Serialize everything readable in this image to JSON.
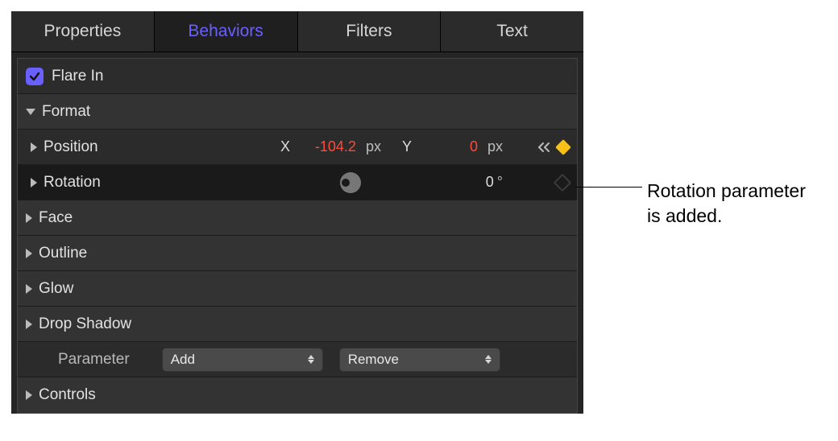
{
  "tabs": {
    "properties": "Properties",
    "behaviors": "Behaviors",
    "filters": "Filters",
    "text": "Text"
  },
  "header": {
    "title": "Flare In"
  },
  "sections": {
    "format": "Format",
    "face": "Face",
    "outline": "Outline",
    "glow": "Glow",
    "dropShadow": "Drop Shadow",
    "controls": "Controls"
  },
  "position": {
    "label": "Position",
    "xLabel": "X",
    "xValue": "-104.2",
    "xUnit": "px",
    "yLabel": "Y",
    "yValue": "0",
    "yUnit": "px"
  },
  "rotation": {
    "label": "Rotation",
    "value": "0",
    "unit": "°"
  },
  "parameterRow": {
    "label": "Parameter",
    "add": "Add",
    "remove": "Remove"
  },
  "callout": {
    "line1": "Rotation parameter",
    "line2": "is added."
  }
}
